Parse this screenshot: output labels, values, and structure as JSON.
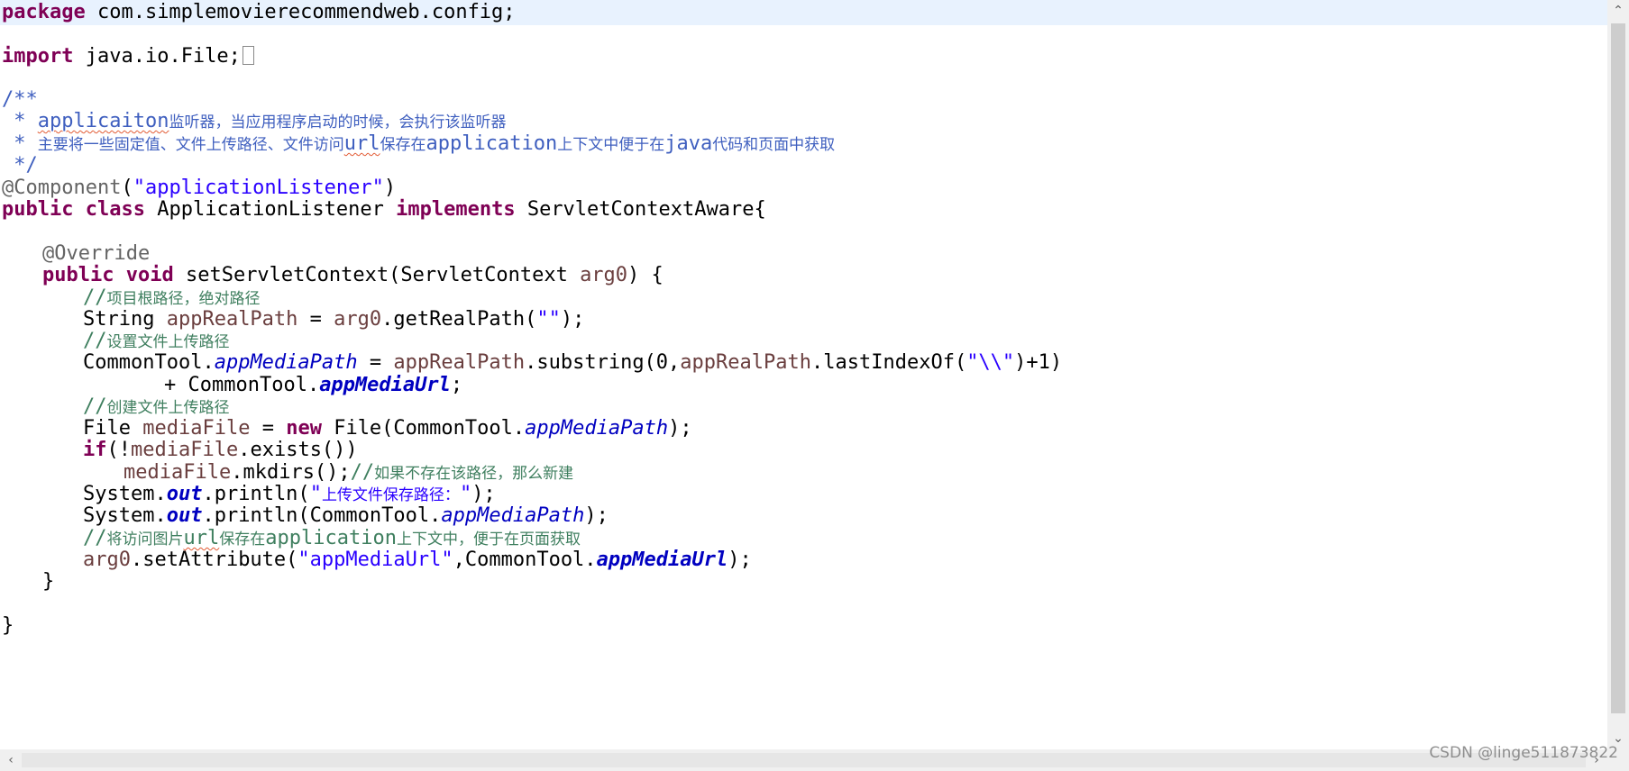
{
  "code": {
    "l1_kw": "package",
    "l1_pkg": " com.simplemovierecommendweb.config;",
    "l3_kw": "import",
    "l3_rest": " java.io.File;",
    "l5": "/**",
    "l6_prefix": " * ",
    "l6_word": "applicaiton",
    "l6_cn": "监听器，当应用程序启动的时候，会执行该监听器",
    "l7_prefix": " * ",
    "l7_cn1": "主要将一些固定值、文件上传路径、文件访问",
    "l7_url": "url",
    "l7_cn2": "保存在",
    "l7_app": "application",
    "l7_cn3": "上下文中便于在",
    "l7_java": "java",
    "l7_cn4": "代码和页面中获取",
    "l8": " */",
    "l9_ann": "@Component",
    "l9_open": "(",
    "l9_str": "\"applicationListener\"",
    "l9_close": ")",
    "l10_kw1": "public",
    "l10_kw2": "class",
    "l10_name": " ApplicationListener ",
    "l10_kw3": "implements",
    "l10_rest": " ServletContextAware{",
    "l12_ann": "@Override",
    "l13_kw1": "public",
    "l13_kw2": "void",
    "l13_sig": " setServletContext(ServletContext ",
    "l13_arg": "arg0",
    "l13_end": ") {",
    "l14_slash": "//",
    "l14_cn": "项目根路径，绝对路径",
    "l15_type": "String ",
    "l15_var": "appRealPath",
    "l15_eq": " = ",
    "l15_arg": "arg0",
    "l15_call": ".getRealPath(",
    "l15_str": "\"\"",
    "l15_end": ");",
    "l16_slash": "//",
    "l16_cn": "设置文件上传路径",
    "l17_cls": "CommonTool.",
    "l17_field": "appMediaPath",
    "l17_eq": " = ",
    "l17_var": "appRealPath",
    "l17_call": ".substring(0,",
    "l17_var2": "appRealPath",
    "l17_call2": ".lastIndexOf(",
    "l17_str": "\"\\\\\"",
    "l17_end": ")+1)",
    "l18_plus": "+ CommonTool.",
    "l18_field": "appMediaUrl",
    "l18_end": ";",
    "l19_slash": "//",
    "l19_cn": "创建文件上传路径",
    "l20_type": "File ",
    "l20_var": "mediaFile",
    "l20_eq": " = ",
    "l20_kw": "new",
    "l20_call": " File(CommonTool.",
    "l20_field": "appMediaPath",
    "l20_end": ");",
    "l21_kw": "if",
    "l21_open": "(!",
    "l21_var": "mediaFile",
    "l21_end": ".exists())",
    "l22_var": "mediaFile",
    "l22_call": ".mkdirs();",
    "l22_slash": "//",
    "l22_cn": "如果不存在该路径，那么新建",
    "l23_sys": "System.",
    "l23_out": "out",
    "l23_call": ".println(",
    "l23_q1": "\"",
    "l23_cn": "上传文件保存路径：",
    "l23_q2": "\"",
    "l23_end": ");",
    "l24_sys": "System.",
    "l24_out": "out",
    "l24_call": ".println(CommonTool.",
    "l24_field": "appMediaPath",
    "l24_end": ");",
    "l25_slash": "//",
    "l25_cn1": "将访问图片",
    "l25_url": "url",
    "l25_cn2": "保存在",
    "l25_app": "application",
    "l25_cn3": "上下文中，便于在页面获取",
    "l26_arg": "arg0",
    "l26_call": ".setAttribute(",
    "l26_str": "\"appMediaUrl\"",
    "l26_mid": ",CommonTool.",
    "l26_field": "appMediaUrl",
    "l26_end": ");",
    "l27": "}",
    "l29": "}"
  },
  "scrollbars": {
    "up_icon": "⌃",
    "down_icon": "⌄",
    "left_icon": "‹",
    "right_icon": "›"
  },
  "watermark": "CSDN @linge511873822",
  "colors": {
    "keyword": "#7f0055",
    "string": "#2a00ff",
    "annotation": "#646464",
    "javadoc": "#3f5fbf",
    "comment": "#3f7f5f",
    "field": "#0000c0",
    "local_variable": "#6a3e3e",
    "current_line": "#e8f2fe"
  }
}
